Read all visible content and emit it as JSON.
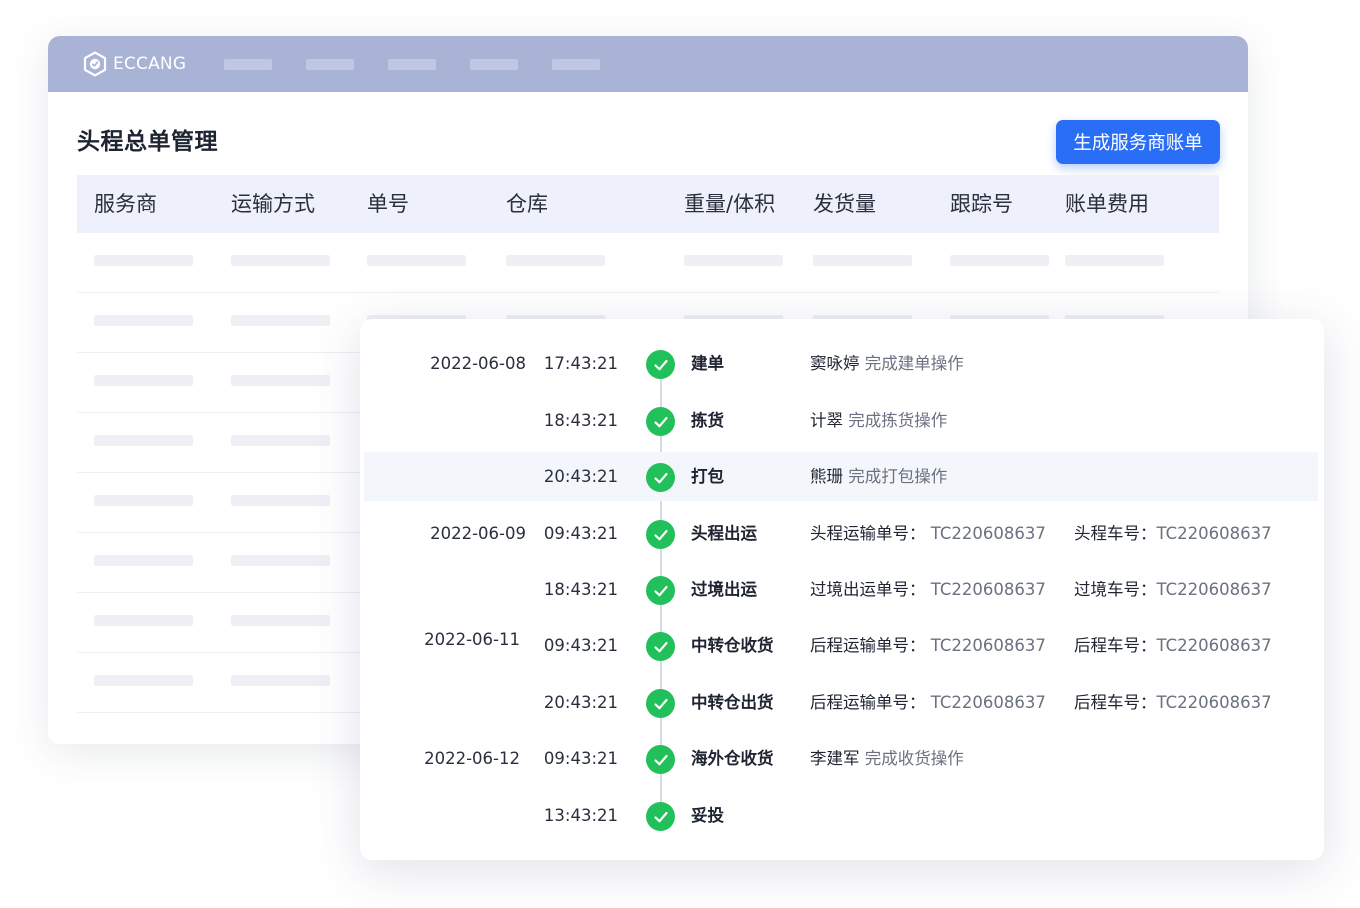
{
  "brand": {
    "name": "ECCANG"
  },
  "page": {
    "title": "头程总单管理",
    "generate_button": "生成服务商账单"
  },
  "table": {
    "columns": [
      "服务商",
      "运输方式",
      "单号",
      "仓库",
      "重量/体积",
      "发货量",
      "跟踪号",
      "账单费用"
    ]
  },
  "timeline": [
    {
      "date": "2022-06-08",
      "time": "17:43:21",
      "stage": "建单",
      "detail1_name": "窦咏婷",
      "detail1_text": "完成建单操作",
      "detail2_key": "",
      "detail2_val": ""
    },
    {
      "date": "",
      "time": "18:43:21",
      "stage": "拣货",
      "detail1_name": "计翠",
      "detail1_text": "完成拣货操作",
      "detail2_key": "",
      "detail2_val": ""
    },
    {
      "date": "",
      "time": "20:43:21",
      "stage": "打包",
      "detail1_name": "熊珊",
      "detail1_text": "完成打包操作",
      "detail2_key": "",
      "detail2_val": ""
    },
    {
      "date": "2022-06-09",
      "time": "09:43:21",
      "stage": "头程出运",
      "detail1_name": "头程运输单号：",
      "detail1_text": "TC220608637",
      "detail2_key": "头程车号：",
      "detail2_val": "TC220608637"
    },
    {
      "date": "",
      "time": "18:43:21",
      "stage": "过境出运",
      "detail1_name": "过境出运单号：",
      "detail1_text": "TC220608637",
      "detail2_key": "过境车号：",
      "detail2_val": "TC220608637"
    },
    {
      "date": "2022-06-11",
      "time": "09:43:21",
      "stage": "中转仓收货",
      "detail1_name": "后程运输单号：",
      "detail1_text": "TC220608637",
      "detail2_key": "后程车号：",
      "detail2_val": "TC220608637"
    },
    {
      "date": "",
      "time": "20:43:21",
      "stage": "中转仓出货",
      "detail1_name": "后程运输单号：",
      "detail1_text": "TC220608637",
      "detail2_key": "后程车号：",
      "detail2_val": "TC220608637"
    },
    {
      "date": "2022-06-12",
      "time": "09:43:21",
      "stage": "海外仓收货",
      "detail1_name": "李建军",
      "detail1_text": "完成收货操作",
      "detail2_key": "",
      "detail2_val": ""
    },
    {
      "date": "",
      "time": "13:43:21",
      "stage": "妥投",
      "detail1_name": "",
      "detail1_text": "",
      "detail2_key": "",
      "detail2_val": ""
    }
  ],
  "colors": {
    "topbar": "#a8b3d6",
    "primary": "#2a6ef5",
    "success": "#22c05b"
  },
  "icons": {
    "logo": "eccang-logo-icon",
    "step": "check-circle-icon"
  }
}
